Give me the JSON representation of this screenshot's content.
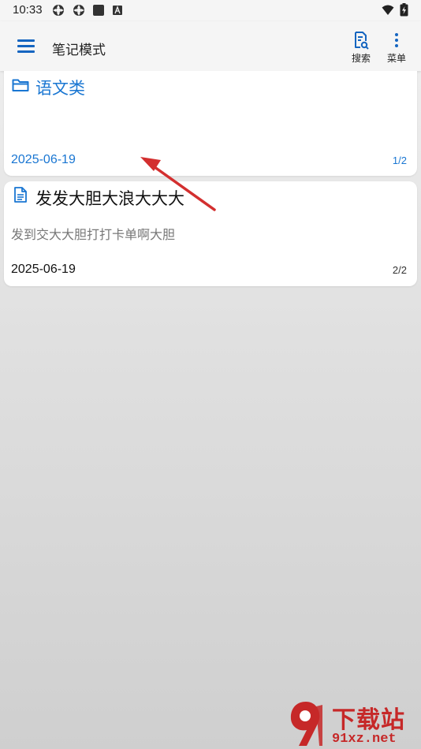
{
  "status_bar": {
    "time": "10:33",
    "icons": [
      "sync-icon",
      "sync-icon",
      "square-app-icon",
      "a-badge-icon",
      "wifi-icon",
      "battery-charging-icon"
    ]
  },
  "app_bar": {
    "title": "笔记模式",
    "search_label": "搜索",
    "menu_label": "菜单",
    "accent_color": "#1565c0"
  },
  "notes": [
    {
      "type": "folder",
      "icon": "folder-icon",
      "title": "语文类",
      "excerpt": "",
      "date": "2025-06-19",
      "page": "1/2",
      "color": "#1976d2"
    },
    {
      "type": "document",
      "icon": "document-icon",
      "title": "发发大胆大浪大大大",
      "excerpt": "发到交大大胆打打卡单啊大胆",
      "date": "2025-06-19",
      "page": "2/2",
      "color": "#111111"
    }
  ],
  "watermark": {
    "title": "下载站",
    "url": "91xz.net"
  },
  "annotation_color": "#d32f2f"
}
